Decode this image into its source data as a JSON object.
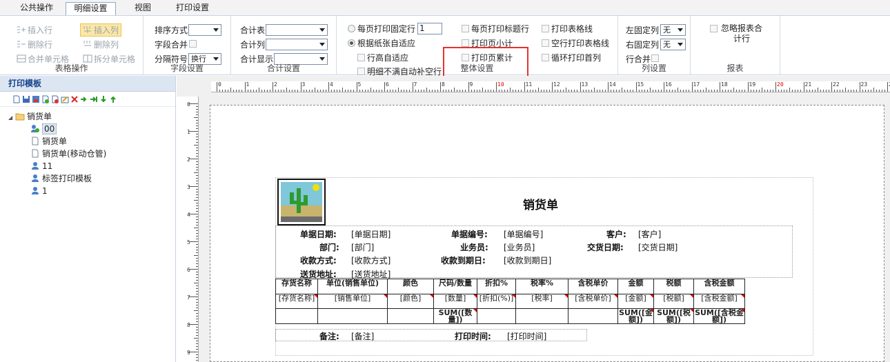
{
  "tabs": [
    {
      "label": "公共操作"
    },
    {
      "label": "明细设置",
      "active": true
    },
    {
      "label": "视图"
    },
    {
      "label": "打印设置"
    }
  ],
  "ribbon": {
    "table_ops": {
      "title": "表格操作",
      "insert_row": "插入行",
      "insert_col": "插入列",
      "delete_row": "删除行",
      "delete_col": "删除列",
      "merge_cell": "合并单元格",
      "split_cell": "拆分单元格"
    },
    "field_settings": {
      "title": "字段设置",
      "sort_label": "排序方式",
      "sort_value": "",
      "merge_label": "字段合并",
      "sep_label": "分隔符号",
      "sep_value": "换行"
    },
    "total_settings": {
      "title": "合计设置",
      "table_label": "合计表",
      "col_label": "合计列",
      "show_label": "合计显示"
    },
    "whole_settings": {
      "title": "整体设置",
      "fixed_rows_label": "每页打印固定行",
      "fixed_rows_value": "1",
      "auto_fit_label": "根据纸张自适应",
      "row_auto_label": "行高自适应",
      "fill_blank_label": "明细不满自动补空行",
      "print_header_label": "每页打印标题行",
      "subtotal_label": "打印页小计",
      "cumulative_label": "打印页累计",
      "grid_label": "打印表格线",
      "empty_grid_label": "空行打印表格线",
      "loop_first_col_label": "循环打印首列"
    },
    "col_settings": {
      "title": "列设置",
      "left_fixed_label": "左固定列",
      "left_fixed_value": "无",
      "right_fixed_label": "右固定列",
      "right_fixed_value": "无",
      "row_merge_label": "行合并"
    },
    "report": {
      "title": "报表",
      "ignore_total_label": "忽略报表合计行"
    }
  },
  "left_panel": {
    "title": "打印模板",
    "tree": [
      {
        "label": "销货单",
        "level": 0,
        "icon": "folder-icon"
      },
      {
        "label": "00",
        "level": 1,
        "icon": "user-group-icon",
        "selected": true
      },
      {
        "label": "销货单",
        "level": 1,
        "icon": "document-icon"
      },
      {
        "label": "销货单(移动仓管)",
        "level": 1,
        "icon": "document-icon"
      },
      {
        "label": "11",
        "level": 1,
        "icon": "user-icon"
      },
      {
        "label": "标签打印模板",
        "level": 1,
        "icon": "user-icon"
      },
      {
        "label": "1",
        "level": 1,
        "icon": "user-icon"
      }
    ]
  },
  "ruler": {
    "top": [
      "0",
      "1",
      "2",
      "3",
      "4",
      "5",
      "6",
      "7",
      "8",
      "9",
      "10",
      "11",
      "12",
      "13",
      "14",
      "15",
      "16",
      "17",
      "18",
      "19",
      "20",
      "21",
      "22",
      "23",
      "24"
    ],
    "left": [
      "0",
      "1",
      "2",
      "3",
      "4",
      "5",
      "6",
      "7",
      "8",
      "9"
    ]
  },
  "report": {
    "title": "销货单",
    "fields": [
      {
        "label": "单据日期:",
        "value": "[单据日期]"
      },
      {
        "label": "单据编号:",
        "value": "[单据编号]"
      },
      {
        "label": "客户:",
        "value": "[客户]"
      },
      {
        "label": "部门:",
        "value": "[部门]"
      },
      {
        "label": "业务员:",
        "value": "[业务员]"
      },
      {
        "label": "交货日期:",
        "value": "[交货日期]"
      },
      {
        "label": "收款方式:",
        "value": "[收款方式]"
      },
      {
        "label": "收款到期日:",
        "value": "[收款到期日]"
      },
      {
        "label": "送货地址:",
        "value": "[送货地址]"
      }
    ],
    "table": {
      "headers": [
        "存货名称",
        "单位(销售单位)",
        "颜色",
        "尺码/数量",
        "折扣%",
        "税率%",
        "含税单价",
        "金额",
        "税额",
        "含税金额"
      ],
      "row": [
        "[存货名称]",
        "[销售单位]",
        "[颜色]",
        "[数量]",
        "[折扣(%)]",
        "[税率]",
        "[含税单价]",
        "[金额]",
        "[税额]",
        "[含税金额]"
      ],
      "sum_row": [
        "",
        "",
        "",
        "SUM([数量])",
        "",
        "",
        "",
        "SUM([金额])",
        "SUM([税额])",
        "SUM([含税金额])"
      ]
    },
    "footer": [
      {
        "label": "备注:",
        "value": "[备注]"
      },
      {
        "label": "打印时间:",
        "value": "[打印时间]"
      }
    ]
  },
  "colors": {
    "accent": "#15428b",
    "highlight_box": "#e5312d",
    "panel_header": "#dce6f2"
  }
}
